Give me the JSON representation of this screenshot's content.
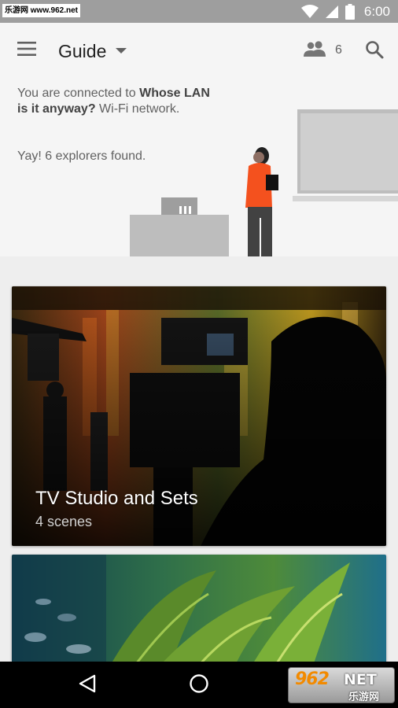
{
  "status_bar": {
    "watermark": "乐游网 www.962.net",
    "time": "6:00",
    "icons": [
      "wifi-icon",
      "signal-icon",
      "battery-icon"
    ]
  },
  "app_bar": {
    "menu_icon": "menu-icon",
    "title": "Guide",
    "dropdown_icon": "dropdown-arrow-icon",
    "people_icon": "people-icon",
    "explorer_count": "6",
    "search_icon": "search-icon"
  },
  "hero": {
    "connected_prefix": "You are connected to ",
    "network_name": "Whose LAN is it anyway?",
    "connected_suffix": " Wi-Fi network.",
    "found_text": "Yay! 6 explorers found."
  },
  "cards": [
    {
      "title": "TV Studio and Sets",
      "subtitle": "4 scenes"
    },
    {
      "title": "",
      "subtitle": ""
    }
  ],
  "nav_bar": {
    "back_icon": "back-icon",
    "home_icon": "home-icon",
    "logo_text": "962",
    "logo_net": "NET",
    "logo_cn": "乐游网"
  },
  "colors": {
    "status_bar": "#9e9e9e",
    "app_bar": "#f5f5f5",
    "background": "#eeeeee",
    "explorer_shirt": "#f4511e"
  }
}
